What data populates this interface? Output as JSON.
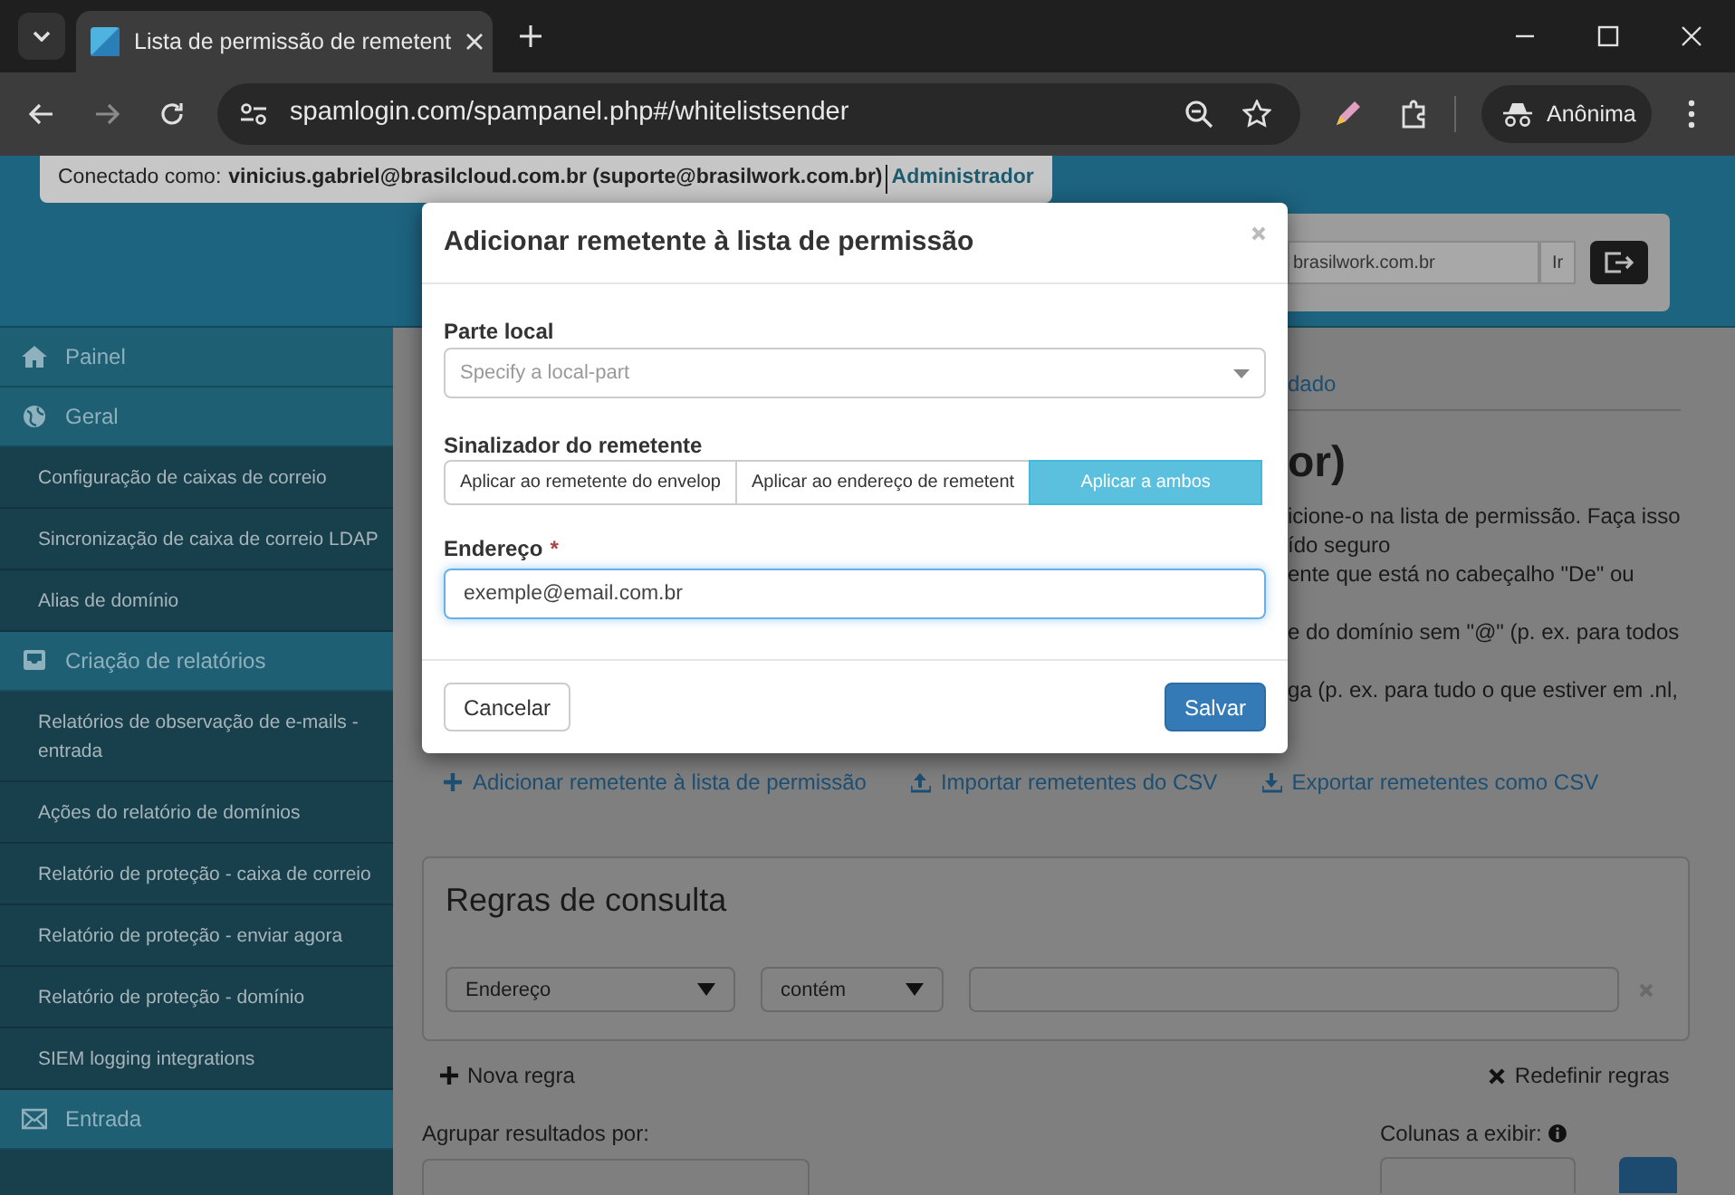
{
  "browser": {
    "tab_title": "Lista de permissão de remetent",
    "url": "spamlogin.com/spampanel.php#/whitelistsender",
    "profile": "Anônima"
  },
  "header": {
    "logged_in_label": "Conectado como:",
    "user": "vinicius.gabriel@brasilcloud.com.br (suporte@brasilwork.com.br)",
    "role": "Administrador",
    "domain_field": "brasilwork.com.br",
    "go_button": "Ir"
  },
  "sidebar": [
    {
      "label": "Painel",
      "kind": "home"
    },
    {
      "label": "Geral",
      "kind": "globe",
      "children": [
        {
          "label": "Configuração de caixas de correio"
        },
        {
          "label": "Sincronização de caixa de correio LDAP"
        },
        {
          "label": "Alias de domínio"
        }
      ]
    },
    {
      "label": "Criação de relatórios",
      "kind": "inbox",
      "children": [
        {
          "label": "Relatórios de observação de e-mails - entrada"
        },
        {
          "label": "Ações do relatório de domínios"
        },
        {
          "label": "Relatório de proteção - caixa de correio"
        },
        {
          "label": "Relatório de proteção - enviar agora"
        },
        {
          "label": "Relatório de proteção - domínio"
        },
        {
          "label": "SIEM logging integrations"
        }
      ]
    },
    {
      "label": "Entrada",
      "kind": "envelope"
    }
  ],
  "content": {
    "tab_fragment": "dado",
    "heading_fragment": "or)",
    "paragraphs": [
      [
        "icione-o na lista de permissão. Faça isso",
        "ído seguro",
        "ente que está no cabeçalho \"De\" ou"
      ],
      [
        "e do domínio sem \"@\" (p. ex. para todos"
      ],
      [
        "ga (p. ex. para tudo o que estiver em .nl,"
      ]
    ],
    "actions": [
      {
        "kind": "plus",
        "label": "Adicionar remetente à lista de permissão"
      },
      {
        "kind": "upload",
        "label": "Importar remetentes do CSV"
      },
      {
        "kind": "download",
        "label": "Exportar remetentes como CSV"
      }
    ],
    "query_rules": {
      "title": "Regras de consulta",
      "field": "Endereço",
      "operator": "contém",
      "add_rule": "Nova regra",
      "reset_rules": "Redefinir regras"
    },
    "group_by_label": "Agrupar resultados por:",
    "columns_label": "Colunas a exibir:"
  },
  "modal": {
    "title": "Adicionar remetente à lista de permissão",
    "local_part": {
      "label": "Parte local",
      "placeholder": "Specify a local-part"
    },
    "sender_flag": {
      "label": "Sinalizador do remetente",
      "options": [
        {
          "label": "Aplicar ao remetente do envelop",
          "selected": false
        },
        {
          "label": "Aplicar ao endereço de remetent",
          "selected": false
        },
        {
          "label": "Aplicar a ambos",
          "selected": true
        }
      ]
    },
    "address": {
      "label": "Endereço",
      "required_mark": "*",
      "value": "exemple@email.com.br"
    },
    "cancel": "Cancelar",
    "save": "Salvar"
  }
}
